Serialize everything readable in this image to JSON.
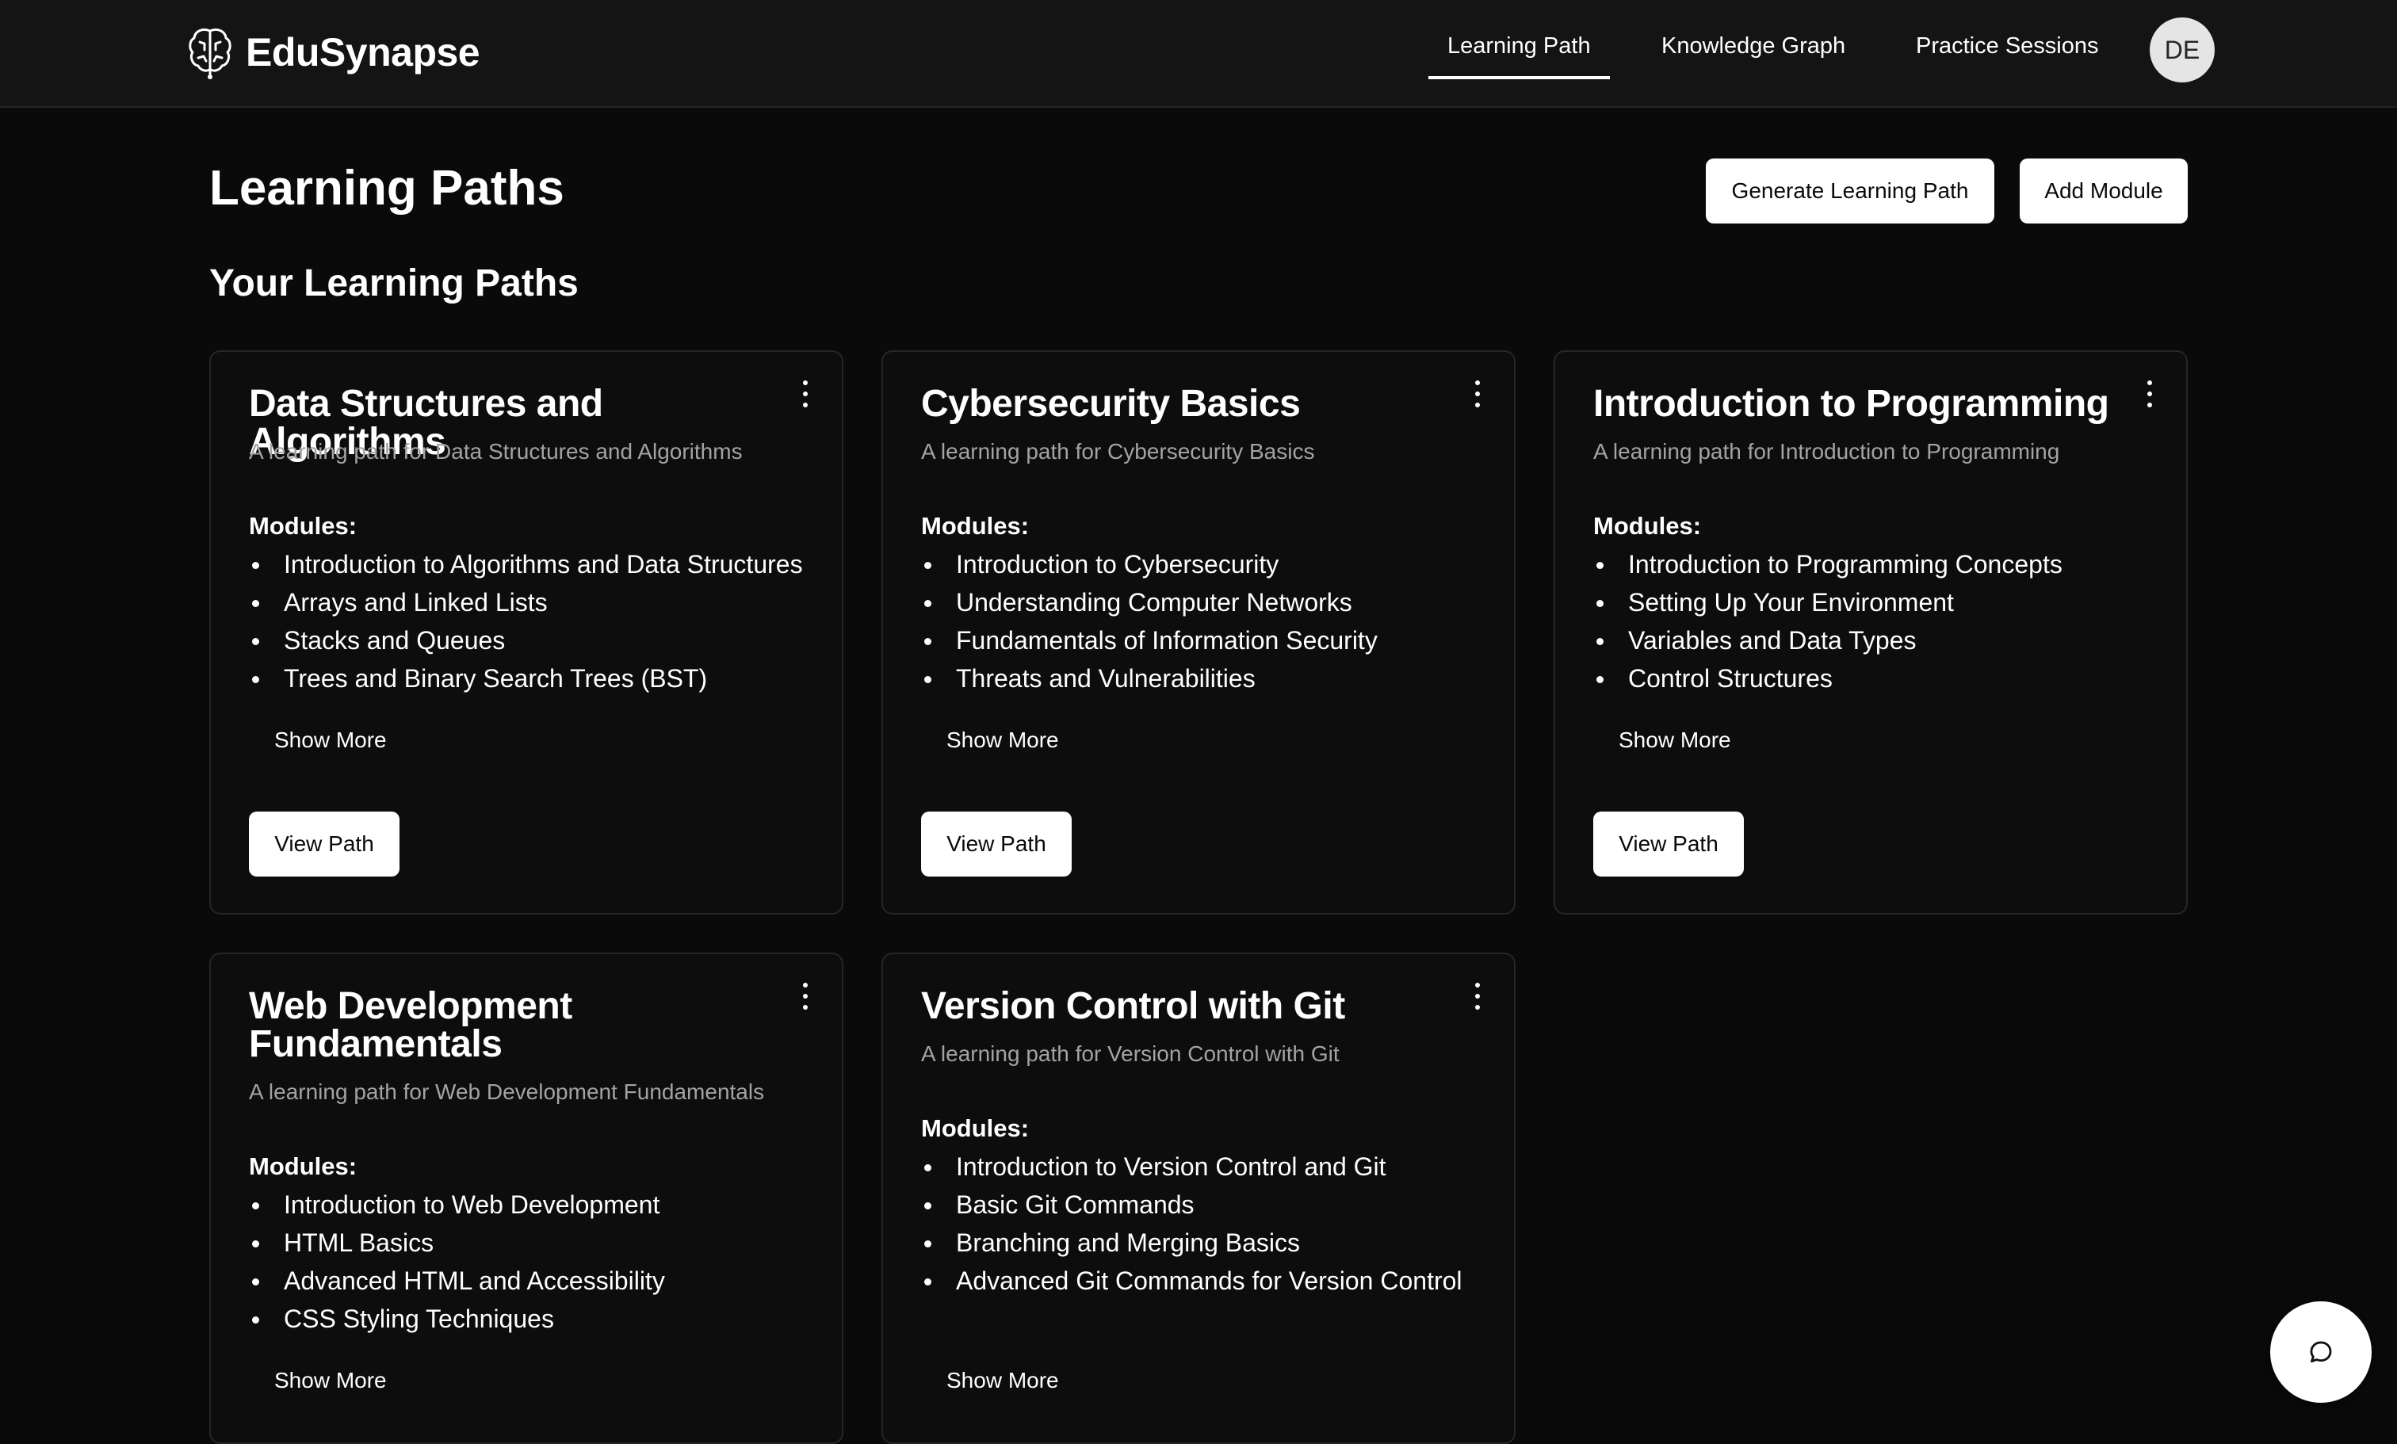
{
  "app": {
    "name": "EduSynapse",
    "brand_icon": "brain-icon"
  },
  "nav": {
    "links": [
      "Learning Path",
      "Knowledge Graph",
      "Practice Sessions"
    ],
    "active": "Learning Path",
    "avatar_initials": "DE"
  },
  "header": {
    "title": "Learning Paths",
    "generate_button": "Generate Learning Path",
    "add_module_button": "Add Module"
  },
  "section_title": "Your Learning Paths",
  "labels": {
    "modules": "Modules:",
    "show_more": "Show More",
    "view_path": "View Path"
  },
  "cards": [
    {
      "title": "Data Structures and Algorithms",
      "description": "A learning path for Data Structures and Algorithms",
      "modules": [
        "Introduction to Algorithms and Data Structures",
        "Arrays and Linked Lists",
        "Stacks and Queues",
        "Trees and Binary Search Trees (BST)"
      ]
    },
    {
      "title": "Cybersecurity Basics",
      "description": "A learning path for Cybersecurity Basics",
      "modules": [
        "Introduction to Cybersecurity",
        "Understanding Computer Networks",
        "Fundamentals of Information Security",
        "Threats and Vulnerabilities"
      ]
    },
    {
      "title": "Introduction to Programming",
      "description": "A learning path for Introduction to Programming",
      "modules": [
        "Introduction to Programming Concepts",
        "Setting Up Your Environment",
        "Variables and Data Types",
        "Control Structures"
      ]
    },
    {
      "title": "Web Development Fundamentals",
      "description": "A learning path for Web Development Fundamentals",
      "modules": [
        "Introduction to Web Development",
        "HTML Basics",
        "Advanced HTML and Accessibility",
        "CSS Styling Techniques"
      ]
    },
    {
      "title": "Version Control with Git",
      "description": "A learning path for Version Control with Git",
      "modules": [
        "Introduction to Version Control and Git",
        "Basic Git Commands",
        "Branching and Merging Basics",
        "Advanced Git Commands for Version Control"
      ]
    }
  ],
  "chat_fab_icon": "chat-bubble-icon",
  "colors": {
    "background": "#0a0a0a",
    "nav_background": "#141414",
    "card_border": "#262626",
    "muted_text": "#a3a3a3"
  }
}
